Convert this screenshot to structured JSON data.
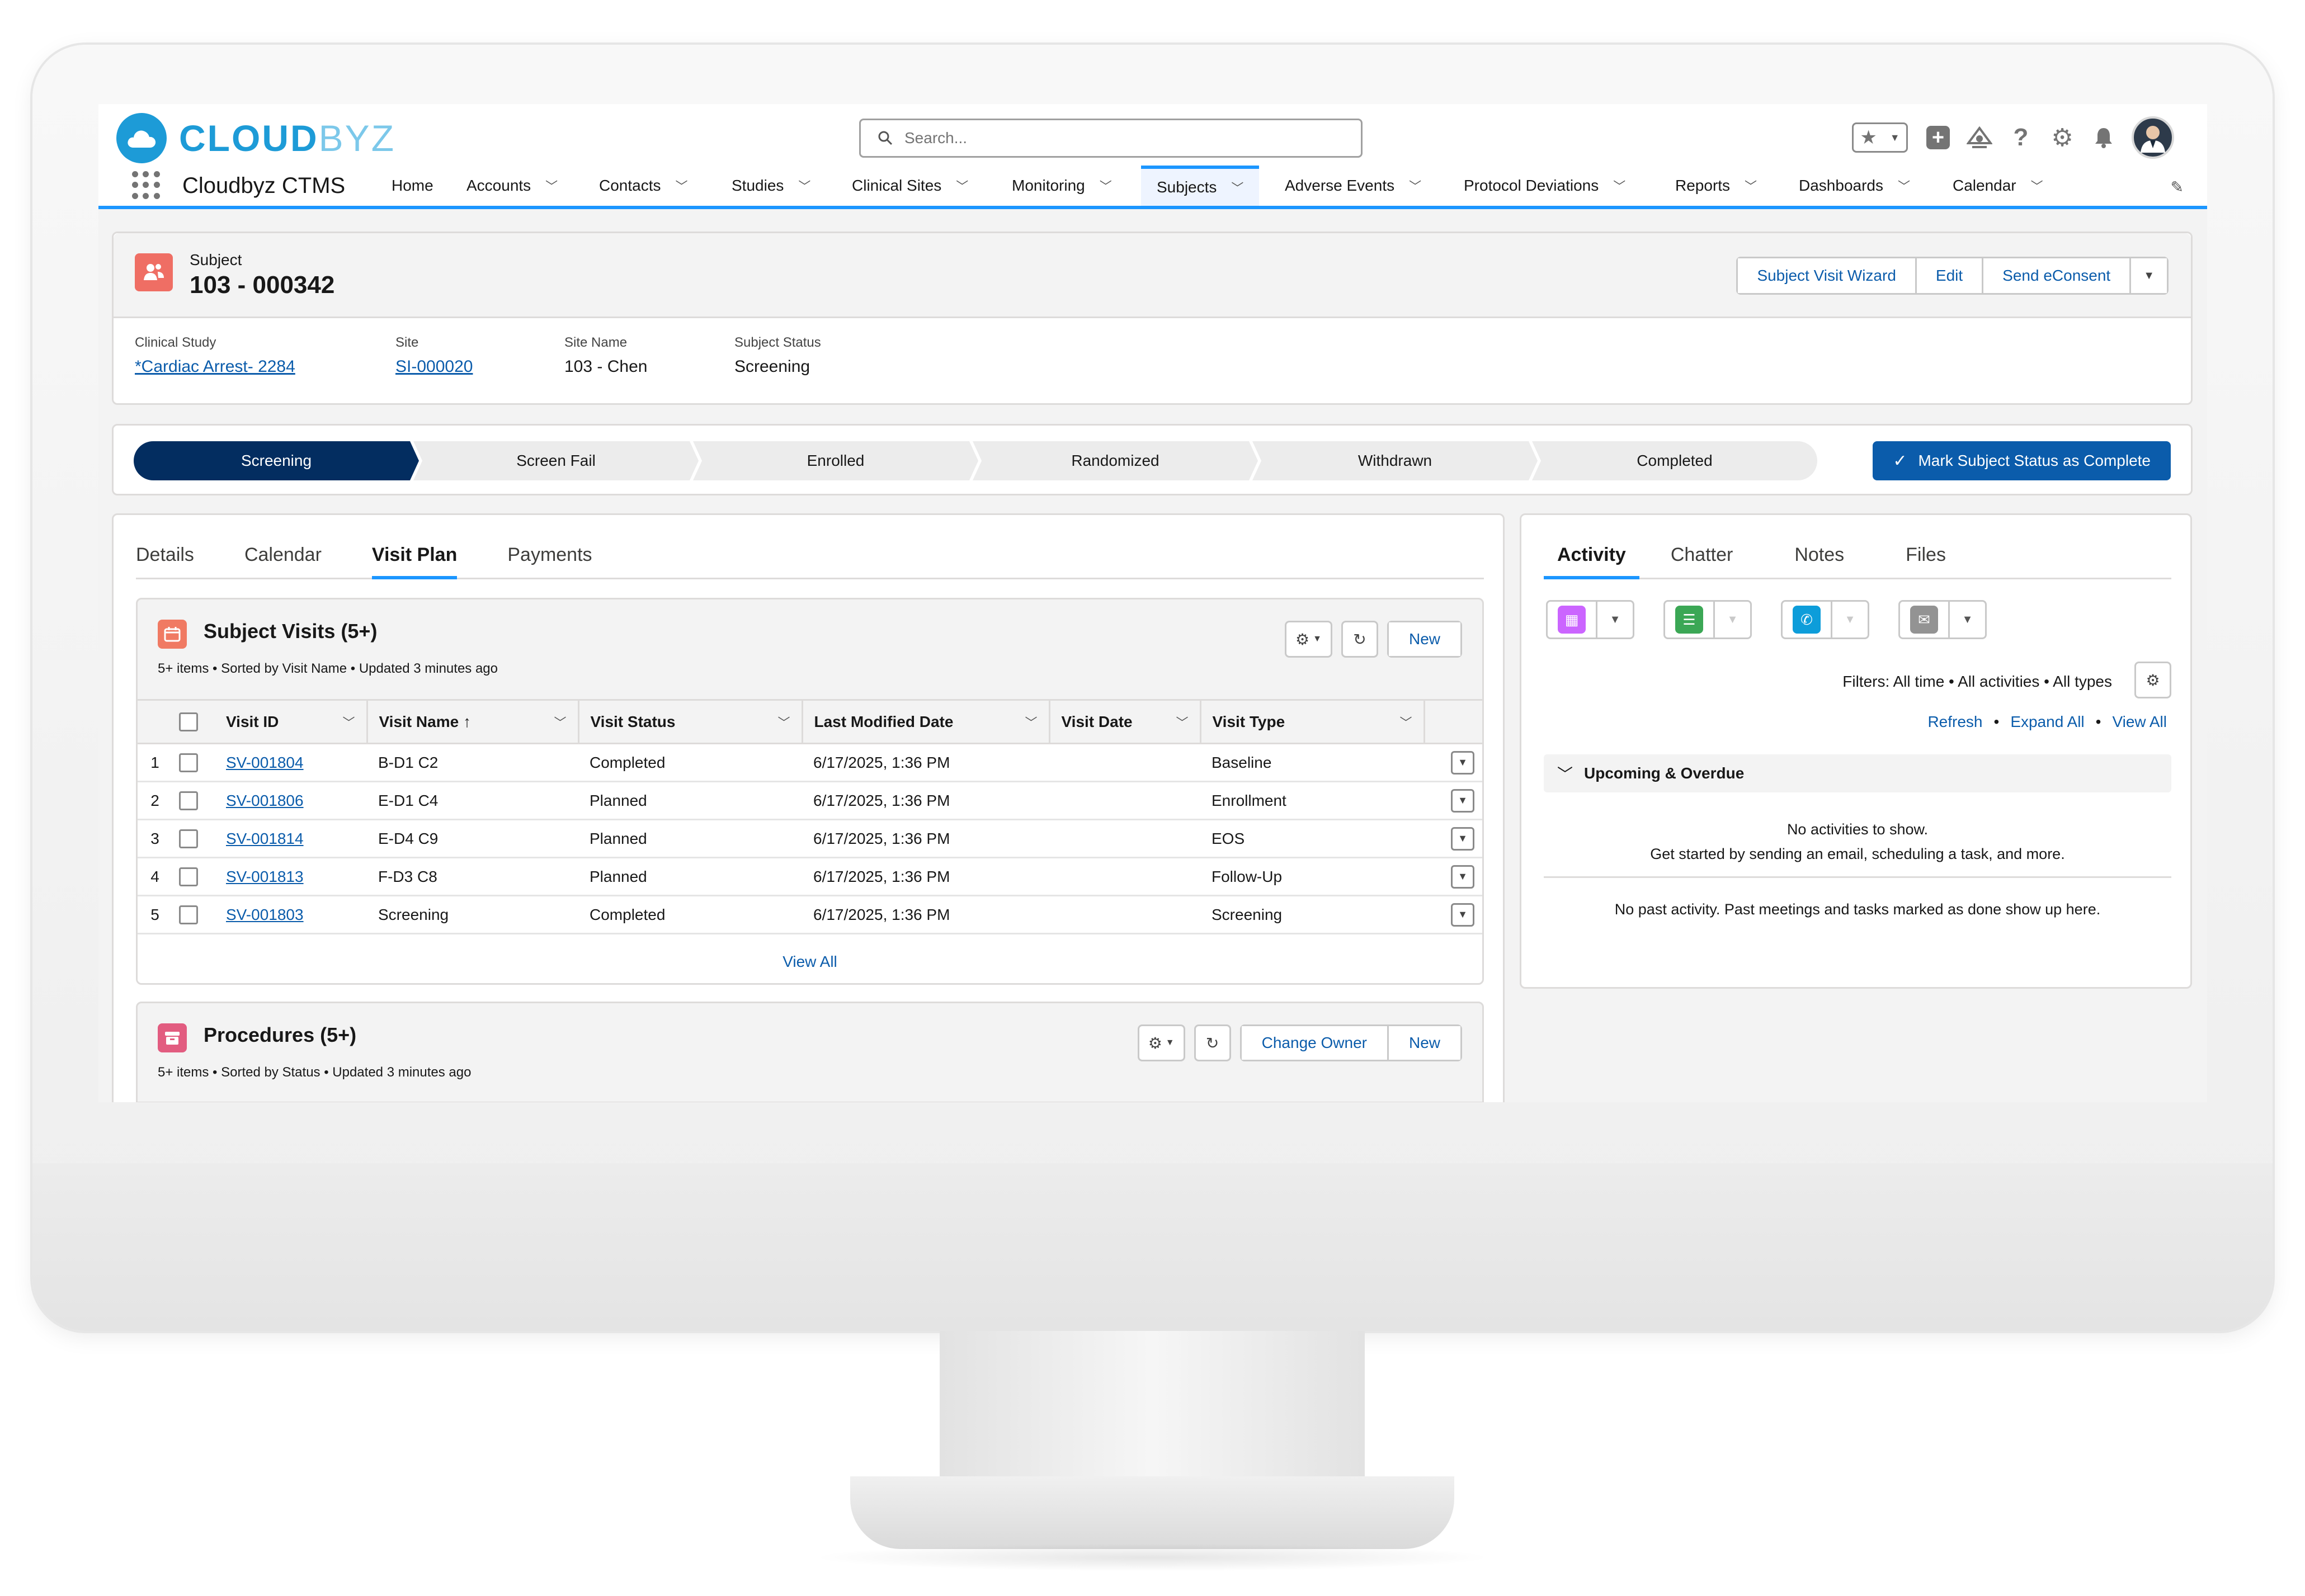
{
  "header": {
    "logo": {
      "part1": "CLOUD",
      "part2": "BYZ"
    },
    "search_placeholder": "Search...",
    "app_name": "Cloudbyz CTMS"
  },
  "nav": [
    {
      "label": "Home",
      "dropdown": false,
      "active": false
    },
    {
      "label": "Accounts",
      "dropdown": true,
      "active": false
    },
    {
      "label": "Contacts",
      "dropdown": true,
      "active": false
    },
    {
      "label": "Studies",
      "dropdown": true,
      "active": false
    },
    {
      "label": "Clinical Sites",
      "dropdown": true,
      "active": false
    },
    {
      "label": "Monitoring",
      "dropdown": true,
      "active": false
    },
    {
      "label": "Subjects",
      "dropdown": true,
      "active": true
    },
    {
      "label": "Adverse Events",
      "dropdown": true,
      "active": false
    },
    {
      "label": "Protocol Deviations",
      "dropdown": true,
      "active": false
    },
    {
      "label": "Reports",
      "dropdown": true,
      "active": false
    },
    {
      "label": "Dashboards",
      "dropdown": true,
      "active": false
    },
    {
      "label": "Calendar",
      "dropdown": true,
      "active": false
    }
  ],
  "record": {
    "type": "Subject",
    "name": "103 - 000342",
    "buttons": [
      "Subject Visit Wizard",
      "Edit",
      "Send eConsent"
    ],
    "fields": [
      {
        "label": "Clinical Study",
        "value": "*Cardiac Arrest- 2284",
        "link": true
      },
      {
        "label": "Site",
        "value": "SI-000020",
        "link": true
      },
      {
        "label": "Site Name",
        "value": "103 - Chen",
        "link": false
      },
      {
        "label": "Subject Status",
        "value": "Screening",
        "link": false
      }
    ]
  },
  "path": {
    "stages": [
      "Screening",
      "Screen Fail",
      "Enrolled",
      "Randomized",
      "Withdrawn",
      "Completed"
    ],
    "current": "Screening",
    "mark_button": "Mark Subject Status as Complete"
  },
  "main_tabs": [
    "Details",
    "Calendar",
    "Visit Plan",
    "Payments"
  ],
  "main_active_tab": "Visit Plan",
  "subject_visits": {
    "title": "Subject Visits (5+)",
    "meta": "5+ items • Sorted by Visit Name • Updated 3 minutes ago",
    "new_label": "New",
    "columns": [
      "Visit ID",
      "Visit Name",
      "Visit Status",
      "Last Modified Date",
      "Visit Date",
      "Visit Type"
    ],
    "sort_indicator": "↑",
    "rows": [
      {
        "num": "1",
        "id": "SV-001804",
        "name": "B-D1 C2",
        "status": "Completed",
        "modified": "6/17/2025, 1:36 PM",
        "date": "",
        "type": "Baseline"
      },
      {
        "num": "2",
        "id": "SV-001806",
        "name": "E-D1 C4",
        "status": "Planned",
        "modified": "6/17/2025, 1:36 PM",
        "date": "",
        "type": "Enrollment"
      },
      {
        "num": "3",
        "id": "SV-001814",
        "name": "E-D4 C9",
        "status": "Planned",
        "modified": "6/17/2025, 1:36 PM",
        "date": "",
        "type": "EOS"
      },
      {
        "num": "4",
        "id": "SV-001813",
        "name": "F-D3 C8",
        "status": "Planned",
        "modified": "6/17/2025, 1:36 PM",
        "date": "",
        "type": "Follow-Up"
      },
      {
        "num": "5",
        "id": "SV-001803",
        "name": "Screening",
        "status": "Completed",
        "modified": "6/17/2025, 1:36 PM",
        "date": "",
        "type": "Screening"
      }
    ],
    "view_all": "View All"
  },
  "procedures": {
    "title": "Procedures (5+)",
    "meta": "5+ items • Sorted by Status • Updated 3 minutes ago",
    "change_owner_label": "Change Owner",
    "new_label": "New"
  },
  "side_tabs": [
    "Activity",
    "Chatter",
    "Notes",
    "Files"
  ],
  "side_active_tab": "Activity",
  "activity": {
    "filters": "Filters: All time • All activities • All types",
    "links": [
      "Refresh",
      "Expand All",
      "View All"
    ],
    "link_separator": "•",
    "upcoming_title": "Upcoming & Overdue",
    "no_activities": "No activities to show.",
    "get_started": "Get started by sending an email, scheduling a task, and more.",
    "no_past": "No past activity. Past meetings and tasks marked as done show up here."
  },
  "icons": {
    "app_launcher": "grid-icon",
    "search": "search-icon",
    "favorites": "star-icon",
    "global_actions": "plus-icon",
    "trailhead": "guidance-icon",
    "help": "help-icon",
    "setup": "gear-icon",
    "notifications": "bell-icon",
    "subject": "person-icon",
    "visits": "calendar-icon",
    "procedures": "archive-icon",
    "event": "event-icon",
    "task": "task-icon",
    "call": "call-icon",
    "email": "email-icon"
  },
  "colors": {
    "brand": "#1d9bd7",
    "path_current": "#032d60",
    "primary_button": "#0b5cab",
    "nav_accent": "#1b96ff",
    "subject_icon": "#ef6e64",
    "visits_icon": "#f07a63",
    "procedures_icon": "#e25c80",
    "event_icon": "#cb65ff",
    "task_icon": "#3ba755",
    "call_icon": "#0d9dda",
    "email_icon": "#939393"
  }
}
